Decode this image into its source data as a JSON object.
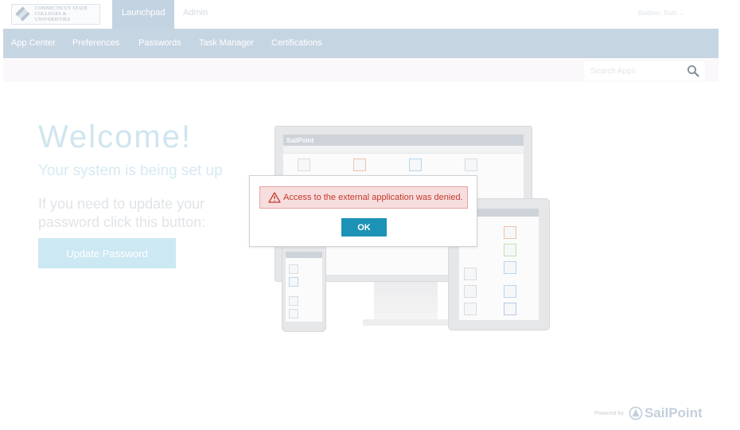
{
  "header": {
    "logo_line1": "CONNECTICUT STATE",
    "logo_line2": "COLLEGES & UNIVERSITIES",
    "tabs": [
      {
        "label": "Launchpad",
        "active": true
      },
      {
        "label": "Admin",
        "active": false
      }
    ],
    "user_name": "Baldwin, Ruth"
  },
  "nav": {
    "items": [
      {
        "label": "App Center"
      },
      {
        "label": "Preferences"
      },
      {
        "label": "Passwords"
      },
      {
        "label": "Task Manager"
      },
      {
        "label": "Certifications"
      }
    ]
  },
  "search": {
    "placeholder": "Search Apps",
    "icon": "search-icon"
  },
  "welcome": {
    "title": "Welcome!",
    "subtitle": "Your system is being set up",
    "info": "If you need to update your password click this button:",
    "button_label": "Update Password"
  },
  "illustration": {
    "brand": "SailPoint"
  },
  "dialog": {
    "message": "Access to the external application was denied.",
    "icon": "warning-icon",
    "ok_label": "OK",
    "colors": {
      "alert_background": "#f7dede",
      "alert_border": "#e8a3a3",
      "alert_text": "#c4392d",
      "ok_button": "#1c93b6"
    }
  },
  "footer": {
    "powered_by": "Powered by",
    "brand": "SailPoint"
  },
  "colors": {
    "nav_bar": "#c6d5e2",
    "active_tab": "#c3d3e2"
  }
}
